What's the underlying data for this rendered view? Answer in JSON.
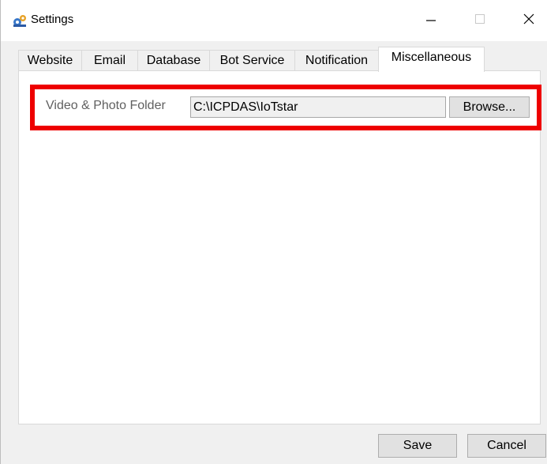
{
  "window": {
    "title": "Settings",
    "icon": "settings-app-icon",
    "controls": {
      "minimize": "minimize-icon",
      "maximize": "maximize-icon",
      "close": "close-icon"
    }
  },
  "tabs": [
    {
      "label": "Website"
    },
    {
      "label": "Email"
    },
    {
      "label": "Database"
    },
    {
      "label": "Bot Service"
    },
    {
      "label": "Notification"
    },
    {
      "label": "Miscellaneous",
      "active": true
    }
  ],
  "misc": {
    "folder_label": "Video & Photo Folder",
    "folder_value": "C:\\ICPDAS\\IoTstar",
    "browse_label": "Browse..."
  },
  "footer": {
    "save_label": "Save",
    "cancel_label": "Cancel"
  },
  "colors": {
    "highlight": "#ee0000"
  }
}
